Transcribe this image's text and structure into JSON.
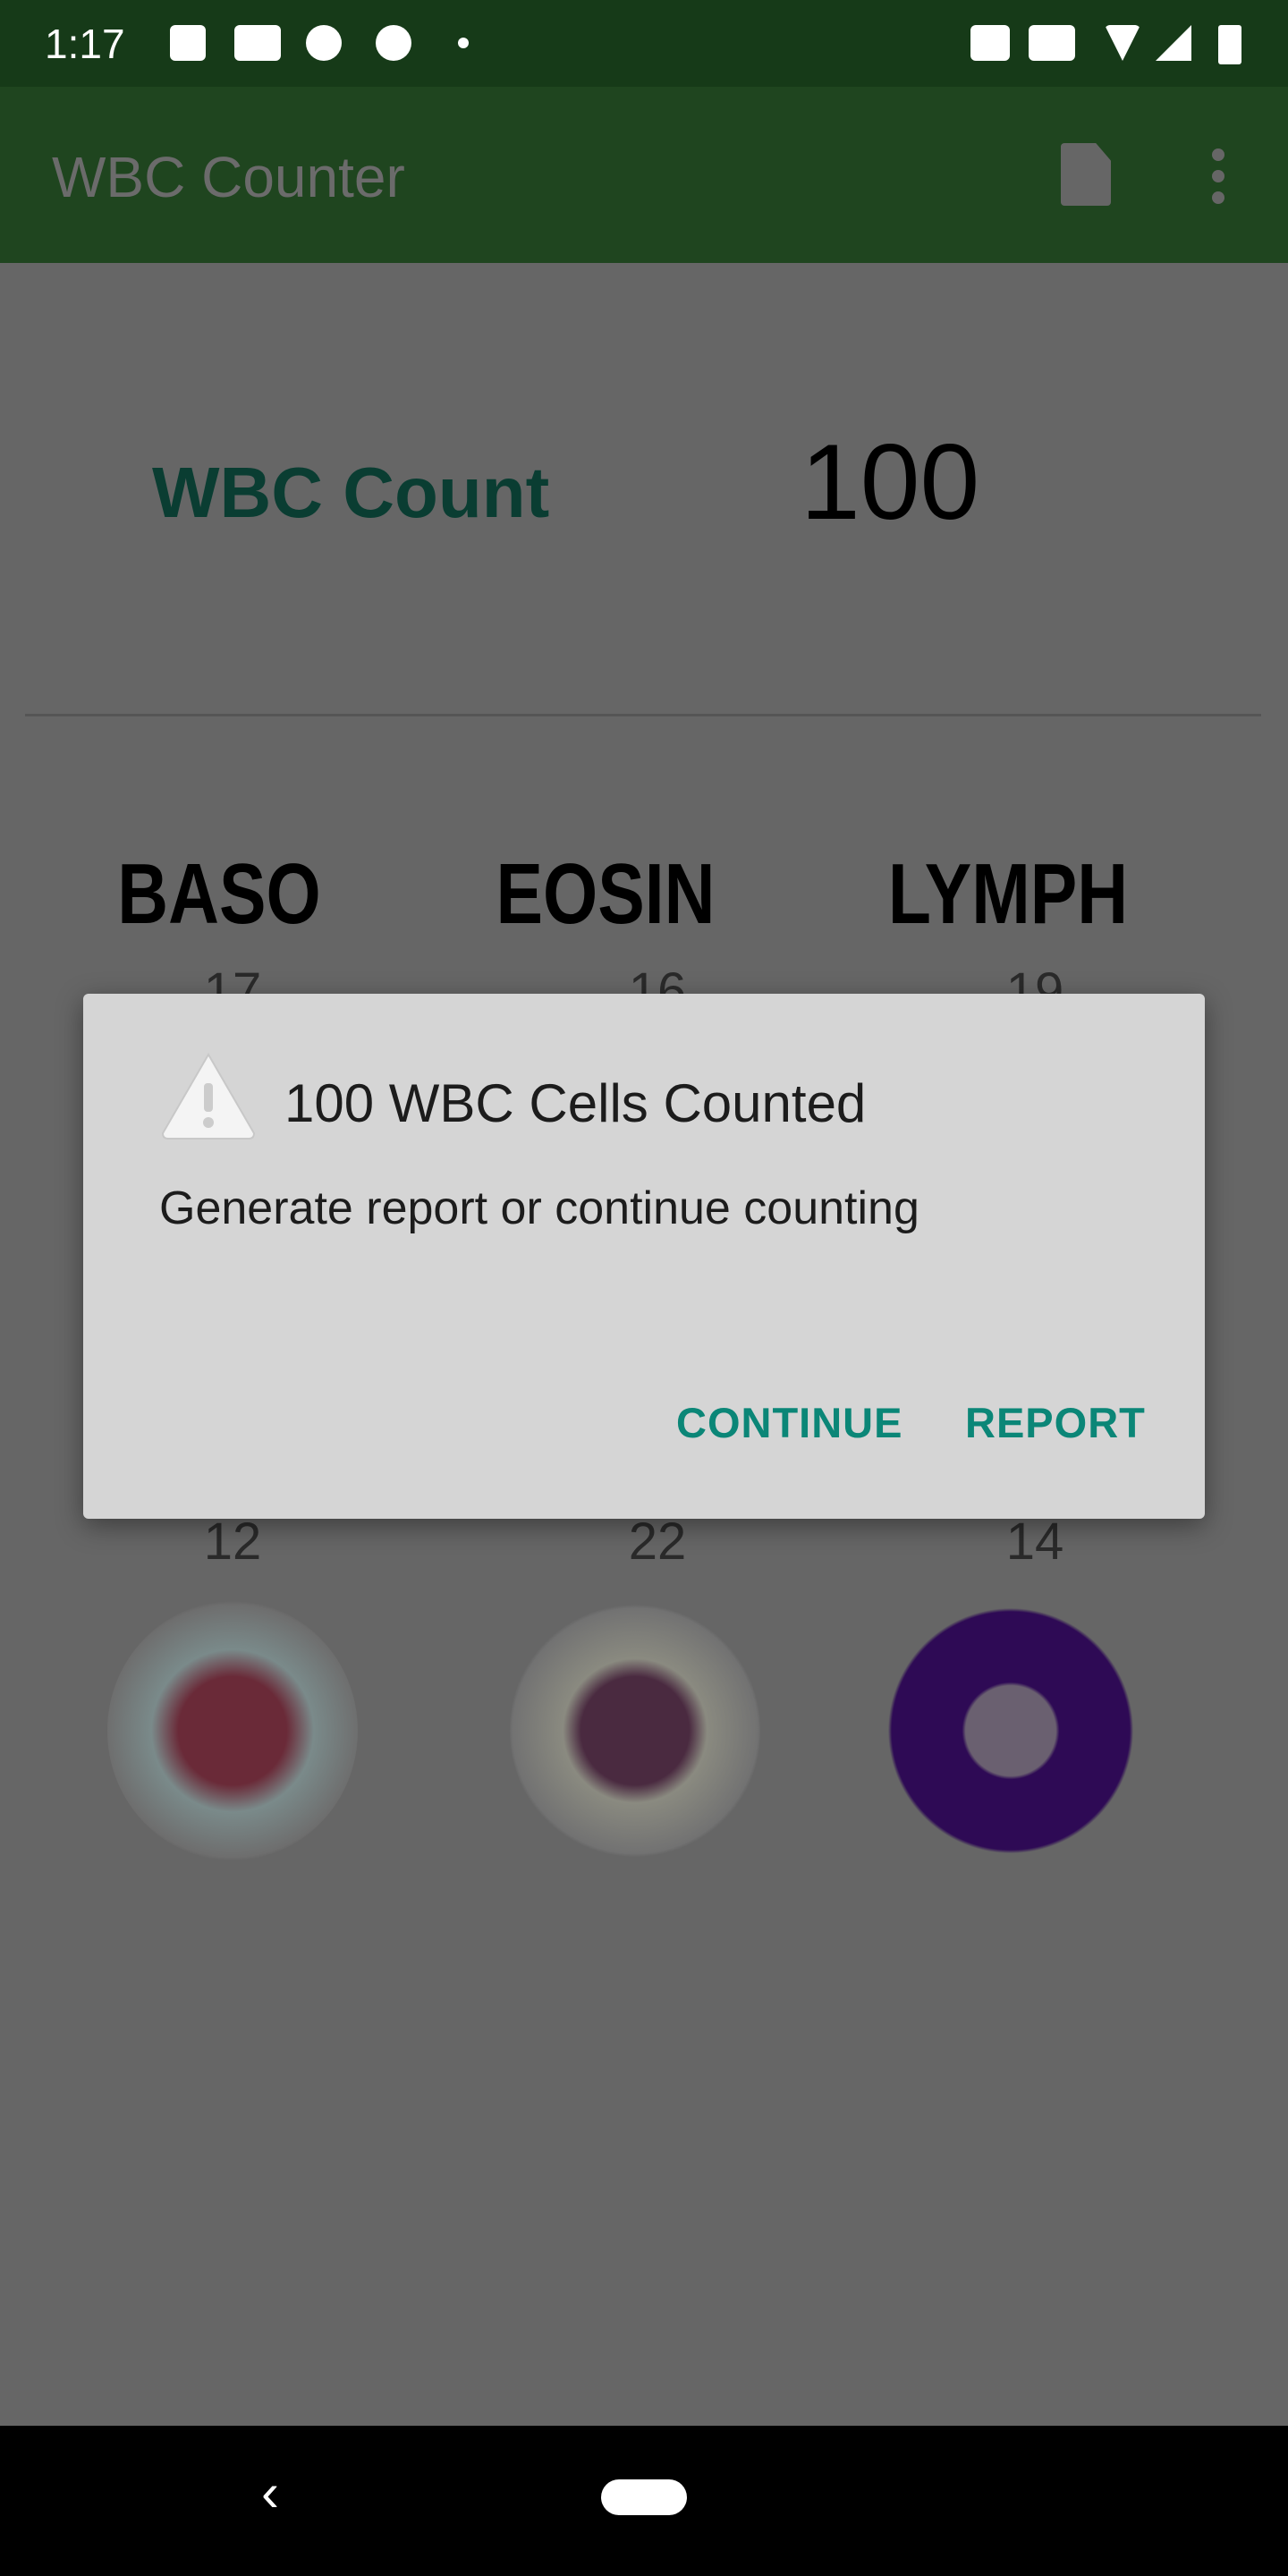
{
  "status_bar": {
    "time": "1:17",
    "icons": [
      "image-icon",
      "youtube-icon",
      "pinterest-icon",
      "pinterest-icon",
      "dot-icon",
      "vpn-key-icon",
      "vibrate-icon",
      "wifi-icon",
      "signal-icon",
      "battery-charging-icon"
    ]
  },
  "app_bar": {
    "title": "WBC Counter",
    "actions": [
      "document-icon",
      "more-vert-icon"
    ]
  },
  "summary": {
    "label": "WBC Count",
    "value": "100"
  },
  "columns": [
    {
      "name": "BASO",
      "count_top": "17",
      "count_bottom": "12"
    },
    {
      "name": "EOSIN",
      "count_top": "16",
      "count_bottom": "22"
    },
    {
      "name": "LYMPH",
      "count_top": "19",
      "count_bottom": "14"
    }
  ],
  "dialog": {
    "icon": "warning-icon",
    "title": "100 WBC Cells Counted",
    "message": "Generate report or continue counting",
    "continue_label": "CONTINUE",
    "report_label": "REPORT"
  },
  "colors": {
    "status_bar": "#163a18",
    "app_bar": "#1f451f",
    "accent": "#0b8677",
    "dialog": "#d5d5d5"
  }
}
